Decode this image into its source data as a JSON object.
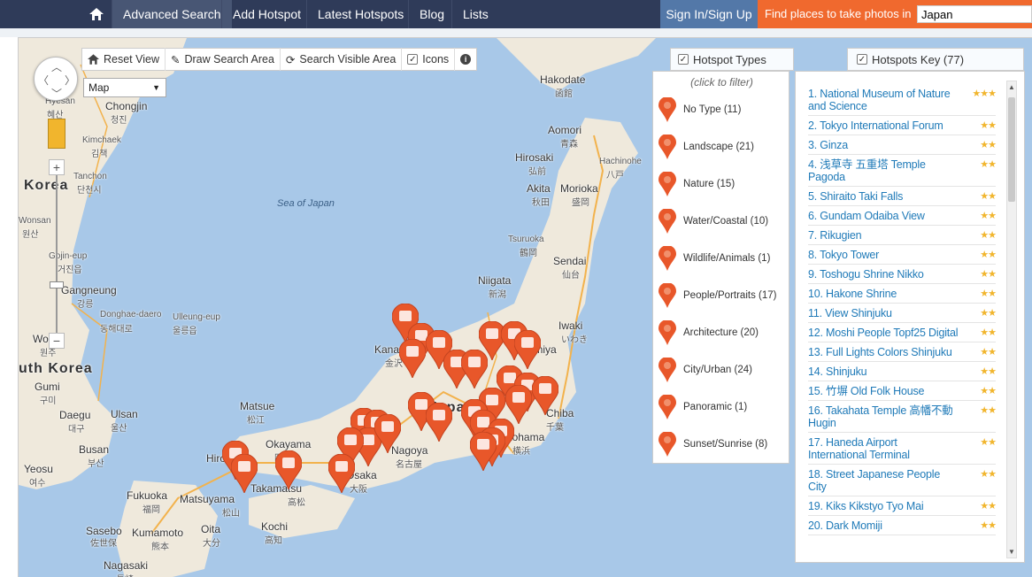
{
  "nav": {
    "items": [
      {
        "label": "Advanced Search"
      },
      {
        "label": "Add Hotspot"
      },
      {
        "label": "Latest Hotspots"
      },
      {
        "label": "Blog"
      },
      {
        "label": "Lists"
      }
    ],
    "signin": "Sign In/Sign Up",
    "find_label": "Find places to take photos in",
    "find_value": "Japan"
  },
  "toolbar": {
    "reset": "Reset View",
    "draw": "Draw Search Area",
    "search_visible": "Search Visible Area",
    "icons": "Icons"
  },
  "map_type": "Map",
  "types_panel": {
    "title": "Hotspot Types",
    "hint": "(click to filter)",
    "items": [
      {
        "label": "No Type (11)",
        "icon": "plain-pin"
      },
      {
        "label": "Landscape (21)",
        "icon": "landscape-pin"
      },
      {
        "label": "Nature (15)",
        "icon": "leaf-pin"
      },
      {
        "label": "Water/Coastal (10)",
        "icon": "waves-pin"
      },
      {
        "label": "Wildlife/Animals (1)",
        "icon": "bird-pin"
      },
      {
        "label": "People/Portraits (17)",
        "icon": "person-pin"
      },
      {
        "label": "Architecture (20)",
        "icon": "arch-pin"
      },
      {
        "label": "City/Urban (24)",
        "icon": "building-pin"
      },
      {
        "label": "Panoramic (1)",
        "icon": "panorama-pin"
      },
      {
        "label": "Sunset/Sunrise (8)",
        "icon": "sun-pin"
      }
    ]
  },
  "key_panel": {
    "title": "Hotspots Key (77)",
    "items": [
      {
        "label": "1. National Museum of Nature and Science",
        "stars": "★★★"
      },
      {
        "label": "2. Tokyo International Forum",
        "stars": "★★"
      },
      {
        "label": "3. Ginza",
        "stars": "★★"
      },
      {
        "label": "4. 浅草寺 五重塔 Temple Pagoda",
        "stars": "★★"
      },
      {
        "label": "5. Shiraito Taki Falls",
        "stars": "★★"
      },
      {
        "label": "6. Gundam Odaiba View",
        "stars": "★★"
      },
      {
        "label": "7. Rikugien",
        "stars": "★★"
      },
      {
        "label": "8. Tokyo Tower",
        "stars": "★★"
      },
      {
        "label": "9. Toshogu Shrine Nikko",
        "stars": "★★"
      },
      {
        "label": "10. Hakone Shrine",
        "stars": "★★"
      },
      {
        "label": "11. View Shinjuku",
        "stars": "★★"
      },
      {
        "label": "12. Moshi People Topf25 Digital",
        "stars": "★★"
      },
      {
        "label": "13. Full Lights Colors Shinjuku",
        "stars": "★★"
      },
      {
        "label": "14. Shinjuku",
        "stars": "★★"
      },
      {
        "label": "15. 竹塀 Old Folk House",
        "stars": "★★"
      },
      {
        "label": "16. Takahata Temple 高幡不動 Hugin",
        "stars": "★★"
      },
      {
        "label": "17. Haneda Airport International Terminal",
        "stars": "★★"
      },
      {
        "label": "18. Street Japanese People City",
        "stars": "★★"
      },
      {
        "label": "19. Kiks Kikstyo Tyo Mai",
        "stars": "★★"
      },
      {
        "label": "20. Dark Momiji",
        "stars": "★★"
      }
    ]
  },
  "map_labels": [
    {
      "text": "Hakodate"
    },
    {
      "text": "函館"
    },
    {
      "text": "Aomori"
    },
    {
      "text": "青森"
    },
    {
      "text": "Hirosaki"
    },
    {
      "text": "弘前"
    },
    {
      "text": "Hachinohe"
    },
    {
      "text": "八戸"
    },
    {
      "text": "Akita"
    },
    {
      "text": "秋田"
    },
    {
      "text": "Morioka"
    },
    {
      "text": "盛岡"
    },
    {
      "text": "Tsuruoka"
    },
    {
      "text": "鶴岡"
    },
    {
      "text": "Sendai"
    },
    {
      "text": "仙台"
    },
    {
      "text": "Niigata"
    },
    {
      "text": "新潟"
    },
    {
      "text": "Iwaki"
    },
    {
      "text": "いわき"
    },
    {
      "text": "Kanazawa"
    },
    {
      "text": "金沢"
    },
    {
      "text": "Omiya"
    },
    {
      "text": "Japan"
    },
    {
      "text": "Chiba"
    },
    {
      "text": "千葉"
    },
    {
      "text": "Yokohama"
    },
    {
      "text": "横浜"
    },
    {
      "text": "Nagoya"
    },
    {
      "text": "名古屋"
    },
    {
      "text": "Osaka"
    },
    {
      "text": "大阪"
    },
    {
      "text": "Matsue"
    },
    {
      "text": "松江"
    },
    {
      "text": "Okayama"
    },
    {
      "text": "岡山"
    },
    {
      "text": "Hiroshima"
    },
    {
      "text": "Takamatsu"
    },
    {
      "text": "高松"
    },
    {
      "text": "Fukuoka"
    },
    {
      "text": "福岡"
    },
    {
      "text": "Matsuyama"
    },
    {
      "text": "松山"
    },
    {
      "text": "Oita"
    },
    {
      "text": "大分"
    },
    {
      "text": "Kochi"
    },
    {
      "text": "高知"
    },
    {
      "text": "Sasebo"
    },
    {
      "text": "佐世保"
    },
    {
      "text": "Kumamoto"
    },
    {
      "text": "熊本"
    },
    {
      "text": "Nagasaki"
    },
    {
      "text": "長崎"
    },
    {
      "text": "Korea"
    },
    {
      "text": "Chongjin"
    },
    {
      "text": "청진"
    },
    {
      "text": "Hyesan"
    },
    {
      "text": "혜산"
    },
    {
      "text": "Kimchaek"
    },
    {
      "text": "김책"
    },
    {
      "text": "Tanchon"
    },
    {
      "text": "단천시"
    },
    {
      "text": "Wonsan"
    },
    {
      "text": "원산"
    },
    {
      "text": "Gojin-eup"
    },
    {
      "text": "거진읍"
    },
    {
      "text": "Gangneung"
    },
    {
      "text": "강릉"
    },
    {
      "text": "Donghae-daero"
    },
    {
      "text": "동해대로"
    },
    {
      "text": "Ulleung-eup"
    },
    {
      "text": "울릉읍"
    },
    {
      "text": "Wonju"
    },
    {
      "text": "원주"
    },
    {
      "text": "uth Korea"
    },
    {
      "text": "Gumi"
    },
    {
      "text": "구미"
    },
    {
      "text": "Daegu"
    },
    {
      "text": "대구"
    },
    {
      "text": "Ulsan"
    },
    {
      "text": "울산"
    },
    {
      "text": "Busan"
    },
    {
      "text": "부산"
    },
    {
      "text": "Yeosu"
    },
    {
      "text": "여수"
    },
    {
      "text": "Sea of Japan"
    }
  ],
  "colors": {
    "nav": "#2f3b59",
    "accent": "#f0692e",
    "pin": "#e8572a",
    "link": "#1f7ab8",
    "star": "#f1b52d"
  }
}
